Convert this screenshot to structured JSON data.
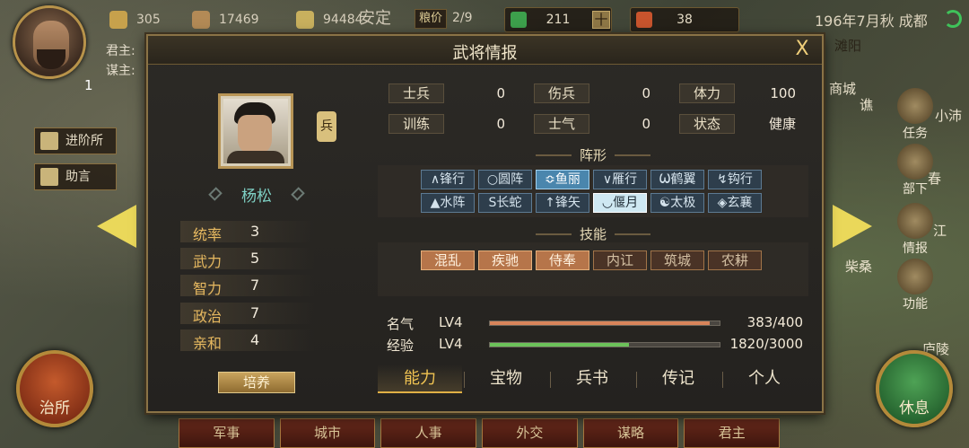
{
  "hud": {
    "level": "1",
    "lord_label": "君主:",
    "advisor_label": "谋主:",
    "gold": "305",
    "wood": "17469",
    "grain": "94484",
    "stability": "安定",
    "price_label": "粮价",
    "price_value": "2/9",
    "jade": "211",
    "jade_plus": "十",
    "token": "38",
    "date_city": "196年7月秋 成都"
  },
  "left_buttons": {
    "promote": "进阶所",
    "advice": "助言"
  },
  "map_labels": {
    "l1": "滩阳",
    "l2": "商城",
    "l3": "谯",
    "l4": "小沛",
    "l5": "春",
    "l6": "江",
    "l7": "柴桑",
    "l8": "庐陵"
  },
  "right_menu": {
    "task": "任务",
    "troops": "部下",
    "intel": "情报",
    "function": "功能"
  },
  "round_buttons": {
    "govern": "治所",
    "rest": "休息"
  },
  "bottom_tabs": [
    "军事",
    "城市",
    "人事",
    "外交",
    "谋略",
    "君主"
  ],
  "dialog": {
    "title": "武将情报",
    "close": "X",
    "general": {
      "name": "杨松",
      "type_badge": "兵",
      "stats": [
        {
          "label": "统率",
          "value": "3"
        },
        {
          "label": "武力",
          "value": "5"
        },
        {
          "label": "智力",
          "value": "7"
        },
        {
          "label": "政治",
          "value": "7"
        },
        {
          "label": "亲和",
          "value": "4"
        }
      ],
      "train_button": "培养"
    },
    "attributes": [
      {
        "label": "士兵",
        "value": "0"
      },
      {
        "label": "伤兵",
        "value": "0"
      },
      {
        "label": "体力",
        "value": "100"
      },
      {
        "label": "训练",
        "value": "0"
      },
      {
        "label": "士气",
        "value": "0"
      },
      {
        "label": "状态",
        "value": "健康"
      }
    ],
    "formation_title": "阵形",
    "formations": [
      {
        "label": "∧锋行",
        "state": "normal"
      },
      {
        "label": "○圆阵",
        "state": "normal"
      },
      {
        "label": "≎鱼丽",
        "state": "active"
      },
      {
        "label": "∨雁行",
        "state": "normal"
      },
      {
        "label": "Ѡ鹤翼",
        "state": "normal"
      },
      {
        "label": "↯钩行",
        "state": "normal"
      },
      {
        "label": "▲水阵",
        "state": "normal"
      },
      {
        "label": "S长蛇",
        "state": "normal"
      },
      {
        "label": "↑锋矢",
        "state": "normal"
      },
      {
        "label": "◡偃月",
        "state": "current"
      },
      {
        "label": "☯太极",
        "state": "normal"
      },
      {
        "label": "◈玄襄",
        "state": "normal"
      }
    ],
    "skills_title": "技能",
    "skills": [
      {
        "label": "混乱",
        "learned": true
      },
      {
        "label": "疾驰",
        "learned": true
      },
      {
        "label": "侍奉",
        "learned": true
      },
      {
        "label": "内讧",
        "learned": false
      },
      {
        "label": "筑城",
        "learned": false
      },
      {
        "label": "农耕",
        "learned": false
      }
    ],
    "progress": [
      {
        "label": "名气",
        "level": "LV4",
        "value": "383/400",
        "fraction": 0.9575,
        "color": "#d8845a"
      },
      {
        "label": "经验",
        "level": "LV4",
        "value": "1820/3000",
        "fraction": 0.6067,
        "color": "#6cc25a"
      }
    ],
    "tabs": [
      "能力",
      "宝物",
      "兵书",
      "传记",
      "个人"
    ],
    "active_tab": 0
  }
}
